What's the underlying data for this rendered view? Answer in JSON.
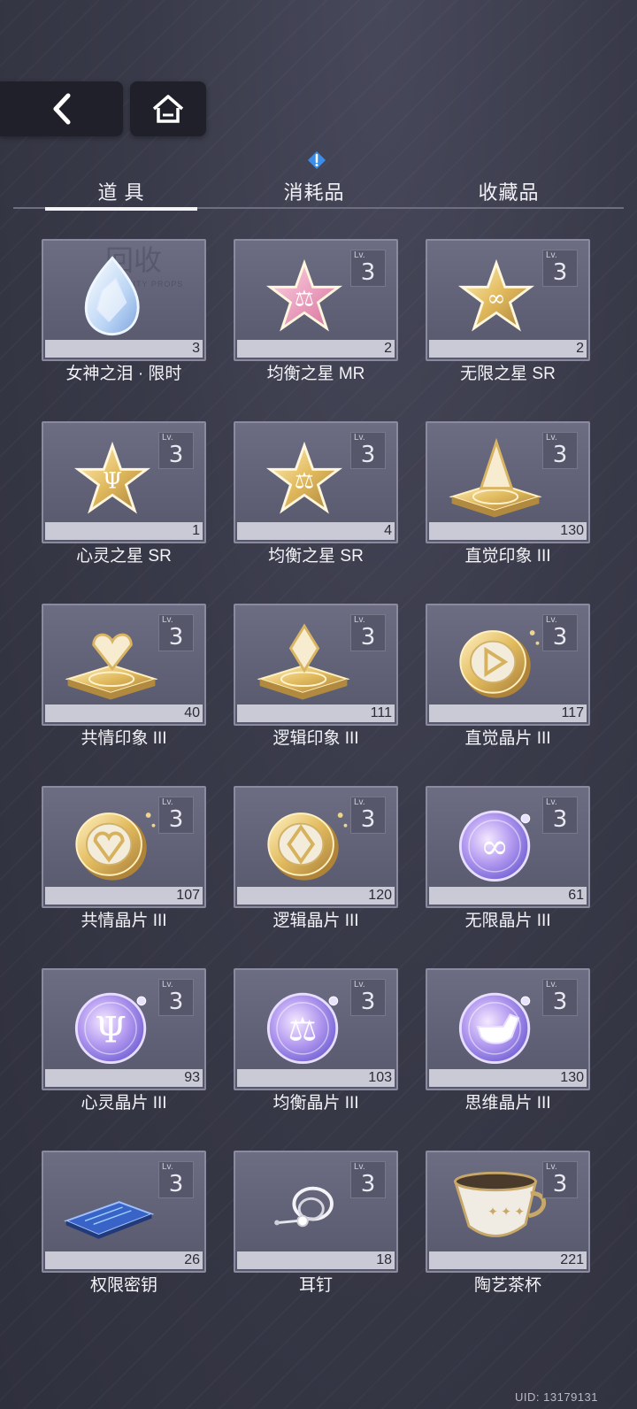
{
  "nav": {
    "back_icon": "chevron-left-icon",
    "home_icon": "home-icon"
  },
  "tabs": [
    {
      "label": "道 具",
      "active": true
    },
    {
      "label": "消耗品",
      "active": false,
      "alert": true
    },
    {
      "label": "收藏品",
      "active": false
    }
  ],
  "level_prefix": "Lv.",
  "items": [
    {
      "name": "女神之泪 · 限时",
      "count": "3",
      "level": null,
      "icon": "tear-crystal-icon",
      "watermark": "回收",
      "watermark_sub": "ACTIVITY PROPS"
    },
    {
      "name": "均衡之星 MR",
      "count": "2",
      "level": "3",
      "icon": "pink-star-icon"
    },
    {
      "name": "无限之星 SR",
      "count": "2",
      "level": "3",
      "icon": "gold-star-infinity-icon"
    },
    {
      "name": "心灵之星 SR",
      "count": "1",
      "level": "3",
      "icon": "gold-star-psi-icon"
    },
    {
      "name": "均衡之星 SR",
      "count": "4",
      "level": "3",
      "icon": "gold-star-scale-icon"
    },
    {
      "name": "直觉印象 III",
      "count": "130",
      "level": "3",
      "icon": "intuition-impression-icon"
    },
    {
      "name": "共情印象 III",
      "count": "40",
      "level": "3",
      "icon": "empathy-impression-icon"
    },
    {
      "name": "逻辑印象 III",
      "count": "111",
      "level": "3",
      "icon": "logic-impression-icon"
    },
    {
      "name": "直觉晶片 III",
      "count": "117",
      "level": "3",
      "icon": "intuition-chip-icon"
    },
    {
      "name": "共情晶片 III",
      "count": "107",
      "level": "3",
      "icon": "empathy-chip-icon"
    },
    {
      "name": "逻辑晶片 III",
      "count": "120",
      "level": "3",
      "icon": "logic-chip-icon"
    },
    {
      "name": "无限晶片 III",
      "count": "61",
      "level": "3",
      "icon": "infinity-chip-icon"
    },
    {
      "name": "心灵晶片 III",
      "count": "93",
      "level": "3",
      "icon": "psi-chip-icon"
    },
    {
      "name": "均衡晶片 III",
      "count": "103",
      "level": "3",
      "icon": "balance-chip-icon"
    },
    {
      "name": "思维晶片 III",
      "count": "130",
      "level": "3",
      "icon": "pipe-chip-icon"
    },
    {
      "name": "权限密钥",
      "count": "26",
      "level": "3",
      "icon": "access-key-card-icon"
    },
    {
      "name": "耳钉",
      "count": "18",
      "level": "3",
      "icon": "earring-icon"
    },
    {
      "name": "陶艺茶杯",
      "count": "221",
      "level": "3",
      "icon": "teacup-icon"
    }
  ],
  "uid": "UID: 13179131",
  "colors": {
    "gold": "#e7c56f",
    "pink": "#e58fb0",
    "purple": "#9d84e6",
    "card": "#626377"
  }
}
